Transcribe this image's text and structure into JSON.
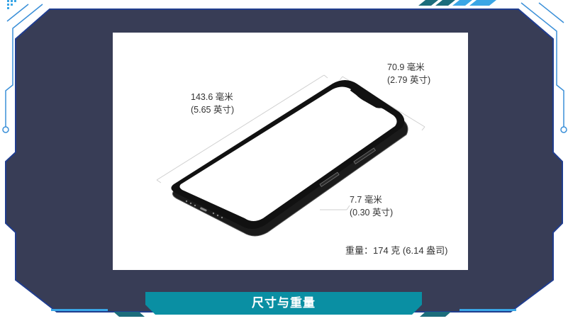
{
  "caption": "尺寸与重量",
  "dimensions": {
    "length": {
      "metric": "143.6 毫米",
      "imperial": "(5.65 英寸)"
    },
    "width": {
      "metric": "70.9 毫米",
      "imperial": "(2.79 英寸)"
    },
    "depth": {
      "metric": "7.7 毫米",
      "imperial": "(0.30 英寸)"
    },
    "weight": "重量：174 克 (6.14 盎司)"
  },
  "colors": {
    "frame_fill": "#383d56",
    "frame_line": "#1f3b8a",
    "circuit": "#3aa6e6",
    "accent_teal": "#0a8fa3",
    "accent_dark": "#1c6d7c"
  }
}
